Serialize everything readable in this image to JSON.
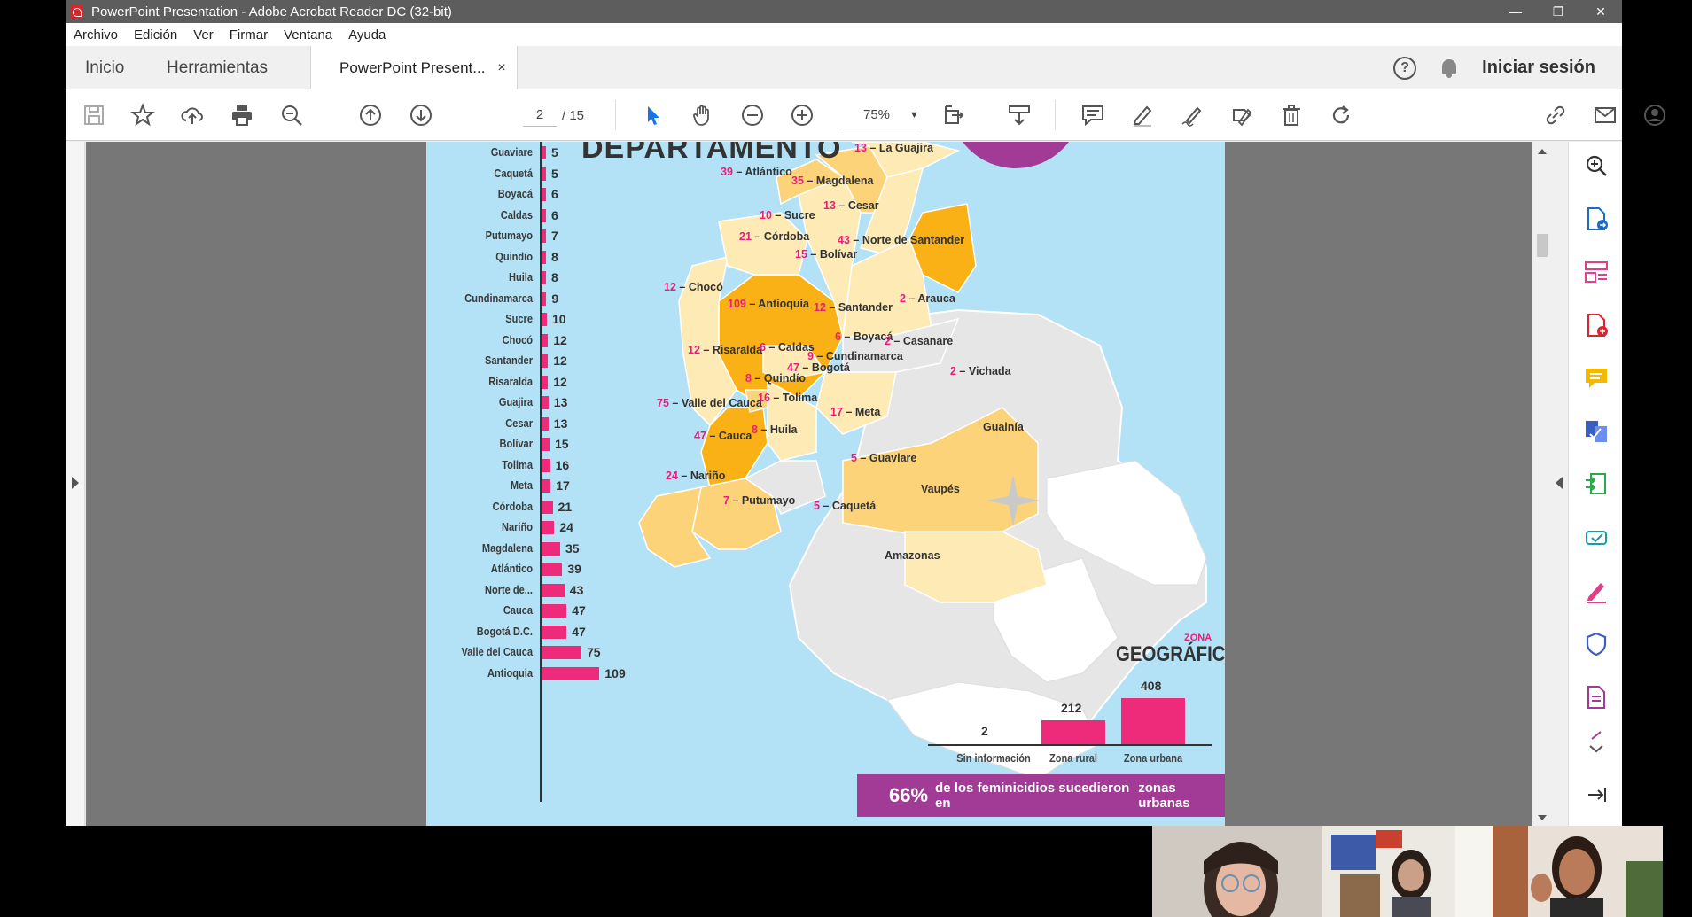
{
  "window": {
    "title": "PowerPoint Presentation - Adobe Acrobat Reader DC (32-bit)",
    "minimize": "—",
    "restore": "❐",
    "close": "✕"
  },
  "menu": [
    "Archivo",
    "Edición",
    "Ver",
    "Firmar",
    "Ventana",
    "Ayuda"
  ],
  "tabs": {
    "home": "Inicio",
    "tools": "Herramientas",
    "document": "PowerPoint Present...",
    "close": "×"
  },
  "header_right": {
    "help": "?",
    "signin": "Iniciar sesión"
  },
  "toolbar": {
    "current_page": "2",
    "page_total": "/ 15",
    "zoom": "75%",
    "zoom_caret": "▼"
  },
  "page": {
    "title": "DEPARTAMENTO",
    "bar_chart": {
      "departments": [
        {
          "name": "Guaviare",
          "value": "5"
        },
        {
          "name": "Caquetá",
          "value": "5"
        },
        {
          "name": "Boyacá",
          "value": "6"
        },
        {
          "name": "Caldas",
          "value": "6"
        },
        {
          "name": "Putumayo",
          "value": "7"
        },
        {
          "name": "Quindío",
          "value": "8"
        },
        {
          "name": "Huila",
          "value": "8"
        },
        {
          "name": "Cundinamarca",
          "value": "9"
        },
        {
          "name": "Sucre",
          "value": "10"
        },
        {
          "name": "Chocó",
          "value": "12"
        },
        {
          "name": "Santander",
          "value": "12"
        },
        {
          "name": "Risaralda",
          "value": "12"
        },
        {
          "name": "Guajira",
          "value": "13"
        },
        {
          "name": "Cesar",
          "value": "13"
        },
        {
          "name": "Bolívar",
          "value": "15"
        },
        {
          "name": "Tolima",
          "value": "16"
        },
        {
          "name": "Meta",
          "value": "17"
        },
        {
          "name": "Córdoba",
          "value": "21"
        },
        {
          "name": "Nariño",
          "value": "24"
        },
        {
          "name": "Magdalena",
          "value": "35"
        },
        {
          "name": "Atlántico",
          "value": "39"
        },
        {
          "name": "Norte de...",
          "value": "43"
        },
        {
          "name": "Cauca",
          "value": "47"
        },
        {
          "name": "Bogotá D.C.",
          "value": "47"
        },
        {
          "name": "Valle del Cauca",
          "value": "75"
        },
        {
          "name": "Antioquia",
          "value": "109"
        }
      ]
    },
    "map_labels": [
      {
        "n": "13",
        "sep": " – ",
        "name": "La Guajira"
      },
      {
        "n": "39",
        "sep": " – ",
        "name": "Atlántico"
      },
      {
        "n": "35",
        "sep": " – ",
        "name": "Magdalena"
      },
      {
        "n": "13",
        "sep": " – ",
        "name": "Cesar"
      },
      {
        "n": "10",
        "sep": " – ",
        "name": "Sucre"
      },
      {
        "n": "21",
        "sep": " – ",
        "name": "Córdoba"
      },
      {
        "n": "43",
        "sep": " – ",
        "name": "Norte de Santander"
      },
      {
        "n": "15",
        "sep": " – ",
        "name": "Bolívar"
      },
      {
        "n": "12",
        "sep": " – ",
        "name": "Chocó"
      },
      {
        "n": "109",
        "sep": " – ",
        "name": "Antioquia"
      },
      {
        "n": "2",
        "sep": " – ",
        "name": "Arauca"
      },
      {
        "n": "12",
        "sep": " – ",
        "name": "Santander"
      },
      {
        "n": "6",
        "sep": " – ",
        "name": "Boyacá"
      },
      {
        "n": "2",
        "sep": " – ",
        "name": "Casanare"
      },
      {
        "n": "12",
        "sep": " – ",
        "name": "Risaralda"
      },
      {
        "n": "6",
        "sep": " – ",
        "name": "Caldas"
      },
      {
        "n": "9",
        "sep": " – ",
        "name": "Cundinamarca"
      },
      {
        "n": "47",
        "sep": " – ",
        "name": "Bogotá"
      },
      {
        "n": "2",
        "sep": " – ",
        "name": "Vichada"
      },
      {
        "n": "8",
        "sep": " – ",
        "name": "Quindío"
      },
      {
        "n": "16",
        "sep": " – ",
        "name": "Tolima"
      },
      {
        "n": "75",
        "sep": " – ",
        "name": "Valle del Cauca"
      },
      {
        "n": "17",
        "sep": " – ",
        "name": "Meta"
      },
      {
        "n": "47",
        "sep": " – ",
        "name": "Cauca"
      },
      {
        "n": "8",
        "sep": " – ",
        "name": "Huila"
      },
      {
        "n": "",
        "sep": "",
        "name": "Guainía"
      },
      {
        "n": "5",
        "sep": " – ",
        "name": "Guaviare"
      },
      {
        "n": "24",
        "sep": " – ",
        "name": "Nariño"
      },
      {
        "n": "",
        "sep": "",
        "name": "Vaupés"
      },
      {
        "n": "7",
        "sep": " – ",
        "name": "Putumayo"
      },
      {
        "n": "5",
        "sep": " – ",
        "name": "Caquetá"
      },
      {
        "n": "",
        "sep": "",
        "name": "Amazonas"
      }
    ],
    "zona": {
      "small": "ZONA",
      "big": "GEOGRÁFICA",
      "bars": [
        {
          "label": "Sin información",
          "value": "2"
        },
        {
          "label": "Zona rural",
          "value": "212"
        },
        {
          "label": "Zona urbana",
          "value": "408"
        }
      ],
      "callout_pct": "66%",
      "callout_text": "de los feminicidios sucedieron en",
      "callout_bold": "zonas urbanas"
    }
  },
  "colors": {
    "bar": "#ee2a7b",
    "page_bg": "#b3e2f6",
    "callout": "#a13b96",
    "map_high": "#f9b115",
    "map_mid": "#fdd37a",
    "map_low": "#fdeab4",
    "map_none": "#e6e6e6"
  },
  "chart_data": {
    "type": "bar",
    "categories": [
      "Guaviare",
      "Caquetá",
      "Boyacá",
      "Caldas",
      "Putumayo",
      "Quindío",
      "Huila",
      "Cundinamarca",
      "Sucre",
      "Chocó",
      "Santander",
      "Risaralda",
      "Guajira",
      "Cesar",
      "Bolívar",
      "Tolima",
      "Meta",
      "Córdoba",
      "Nariño",
      "Magdalena",
      "Atlántico",
      "Norte de...",
      "Cauca",
      "Bogotá D.C.",
      "Valle del Cauca",
      "Antioquia"
    ],
    "values": [
      5,
      5,
      6,
      6,
      7,
      8,
      8,
      9,
      10,
      12,
      12,
      12,
      13,
      13,
      15,
      16,
      17,
      21,
      24,
      35,
      39,
      43,
      47,
      47,
      75,
      109
    ],
    "orientation": "horizontal",
    "second_chart": {
      "type": "bar",
      "categories": [
        "Sin información",
        "Zona rural",
        "Zona urbana"
      ],
      "values": [
        2,
        212,
        408
      ]
    }
  }
}
